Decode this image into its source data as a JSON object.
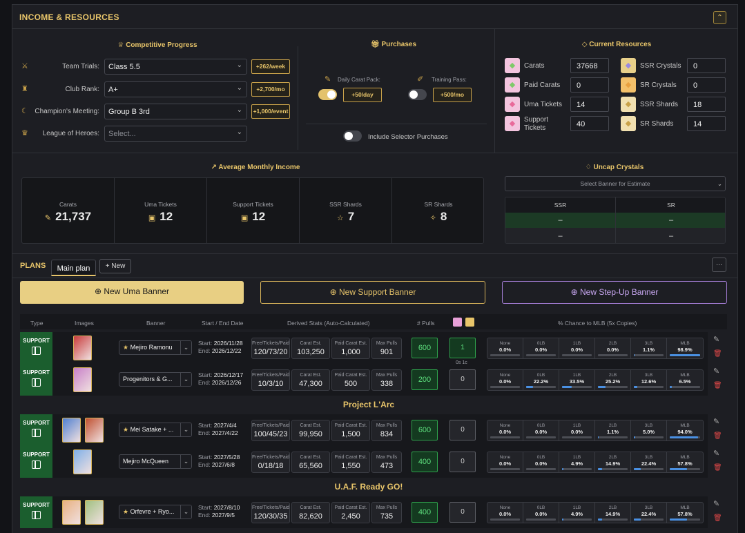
{
  "section": {
    "title": "INCOME & RESOURCES",
    "collapse_icon": "chevron-up-icon"
  },
  "competitive": {
    "title": "Competitive Progress",
    "rows": [
      {
        "label": "Team Trials:",
        "value": "Class 5.5",
        "badge": "+262/week",
        "icon": "sword-icon"
      },
      {
        "label": "Club Rank:",
        "value": "A+",
        "badge": "+2,700/mo",
        "icon": "club-icon"
      },
      {
        "label": "Champion's Meeting:",
        "value": "Group B 3rd",
        "badge": "+1,000/event",
        "icon": "moon-icon"
      },
      {
        "label": "League of Heroes:",
        "value": "",
        "placeholder": "Select...",
        "icon": "crown-icon"
      }
    ]
  },
  "purchases": {
    "title": "Purchases",
    "daily": {
      "label": "Daily Carat Pack:",
      "badge": "+50/day",
      "on": true
    },
    "training": {
      "label": "Training Pass:",
      "badge": "+500/mo",
      "on": false
    },
    "selector": {
      "label": "Include Selector Purchases",
      "on": false
    }
  },
  "resources": {
    "title": "Current Resources",
    "items": [
      {
        "label": "Carats",
        "value": "37668"
      },
      {
        "label": "Paid Carats",
        "value": "0"
      },
      {
        "label": "Uma Tickets",
        "value": "14"
      },
      {
        "label": "Support Tickets",
        "value": "40"
      },
      {
        "label": "SSR Crystals",
        "value": "0"
      },
      {
        "label": "SR Crystals",
        "value": "0"
      },
      {
        "label": "SSR Shards",
        "value": "18"
      },
      {
        "label": "SR Shards",
        "value": "14"
      }
    ]
  },
  "avg": {
    "title": "Average Monthly Income",
    "cells": [
      {
        "label": "Carats",
        "value": "21,737",
        "icon": "✎"
      },
      {
        "label": "Uma Tickets",
        "value": "12",
        "icon": "▣"
      },
      {
        "label": "Support Tickets",
        "value": "12",
        "icon": "▣"
      },
      {
        "label": "SSR Shards",
        "value": "7",
        "icon": "☆"
      },
      {
        "label": "SR Shards",
        "value": "8",
        "icon": "✧"
      }
    ]
  },
  "uncap": {
    "title": "Uncap Crystals",
    "select_placeholder": "Select Banner for Estimate",
    "cols": [
      "SSR",
      "SR"
    ],
    "rows": [
      [
        "–",
        "–"
      ],
      [
        "–",
        "–"
      ]
    ]
  },
  "plans": {
    "title": "PLANS",
    "tabs": [
      "Main plan"
    ],
    "new_tab": "+ New",
    "more": "···"
  },
  "buttons": {
    "uma": "⊕ New Uma Banner",
    "support": "⊕ New Support Banner",
    "stepup": "⊕ New Step-Up Banner"
  },
  "table_headers": {
    "type": "Type",
    "images": "Images",
    "banner": "Banner",
    "dates": "Start / End Date",
    "derived": "Derived Stats (Auto-Calculated)",
    "pulls": "# Pulls",
    "mlb": "% Chance to MLB (5x Copies)"
  },
  "stat_labels": [
    "Free/Tickets/Paid",
    "Carat Est.",
    "Paid Carat Est.",
    "Max Pulls"
  ],
  "mlb_labels": [
    "None",
    "0LB",
    "1LB",
    "2LB",
    "3LB",
    "MLB"
  ],
  "type_label": "SUPPORT",
  "start_label": "Start:",
  "end_label": "End:",
  "crystal_note": "0s 1c",
  "rows": [
    {
      "banner": "Mejiro Ramonu",
      "star": true,
      "start": "2026/11/28",
      "end": "2026/12/22",
      "ftp": "120/73/20",
      "carat": "103,250",
      "paid": "1,000",
      "max": "901",
      "pulls": "600",
      "crys": "1",
      "mlb": [
        "0.0%",
        "0.0%",
        "0.0%",
        "0.0%",
        "1.1%",
        "98.9%"
      ],
      "fill": [
        0,
        0,
        0,
        0,
        1.1,
        98.9
      ]
    },
    {
      "banner": "Progenitors & G...",
      "star": false,
      "start": "2026/12/17",
      "end": "2026/12/26",
      "ftp": "10/3/10",
      "carat": "47,300",
      "paid": "500",
      "max": "338",
      "pulls": "200",
      "crys": "0",
      "mlb": [
        "0.0%",
        "22.2%",
        "33.5%",
        "25.2%",
        "12.6%",
        "6.5%"
      ],
      "fill": [
        0,
        22.2,
        33.5,
        25.2,
        12.6,
        6.5
      ]
    },
    {
      "banner": "Mei Satake + ...",
      "star": true,
      "start": "2027/4/4",
      "end": "2027/4/22",
      "ftp": "100/45/23",
      "carat": "99,950",
      "paid": "1,500",
      "max": "834",
      "pulls": "600",
      "crys": "0",
      "mlb": [
        "0.0%",
        "0.0%",
        "0.0%",
        "1.1%",
        "5.0%",
        "94.0%"
      ],
      "fill": [
        0,
        0,
        0,
        1.1,
        5,
        94
      ]
    },
    {
      "banner": "Mejiro McQueen",
      "star": false,
      "start": "2027/5/28",
      "end": "2027/6/8",
      "ftp": "0/18/18",
      "carat": "65,560",
      "paid": "1,550",
      "max": "473",
      "pulls": "400",
      "crys": "0",
      "mlb": [
        "0.0%",
        "0.0%",
        "4.9%",
        "14.9%",
        "22.4%",
        "57.8%"
      ],
      "fill": [
        0,
        0,
        4.9,
        14.9,
        22.4,
        57.8
      ]
    },
    {
      "banner": "Orfevre + Ryo...",
      "star": true,
      "start": "2027/8/10",
      "end": "2027/9/5",
      "ftp": "120/30/35",
      "carat": "82,620",
      "paid": "2,450",
      "max": "735",
      "pulls": "400",
      "crys": "0",
      "mlb": [
        "0.0%",
        "0.0%",
        "4.9%",
        "14.9%",
        "22.4%",
        "57.8%"
      ],
      "fill": [
        0,
        0,
        4.9,
        14.9,
        22.4,
        57.8
      ]
    }
  ],
  "groups": [
    "Project L'Arc",
    "U.A.F. Ready GO!"
  ],
  "colors": {
    "accent": "#e8c56a",
    "green": "#1b5e2e",
    "purple": "#b388e8"
  }
}
